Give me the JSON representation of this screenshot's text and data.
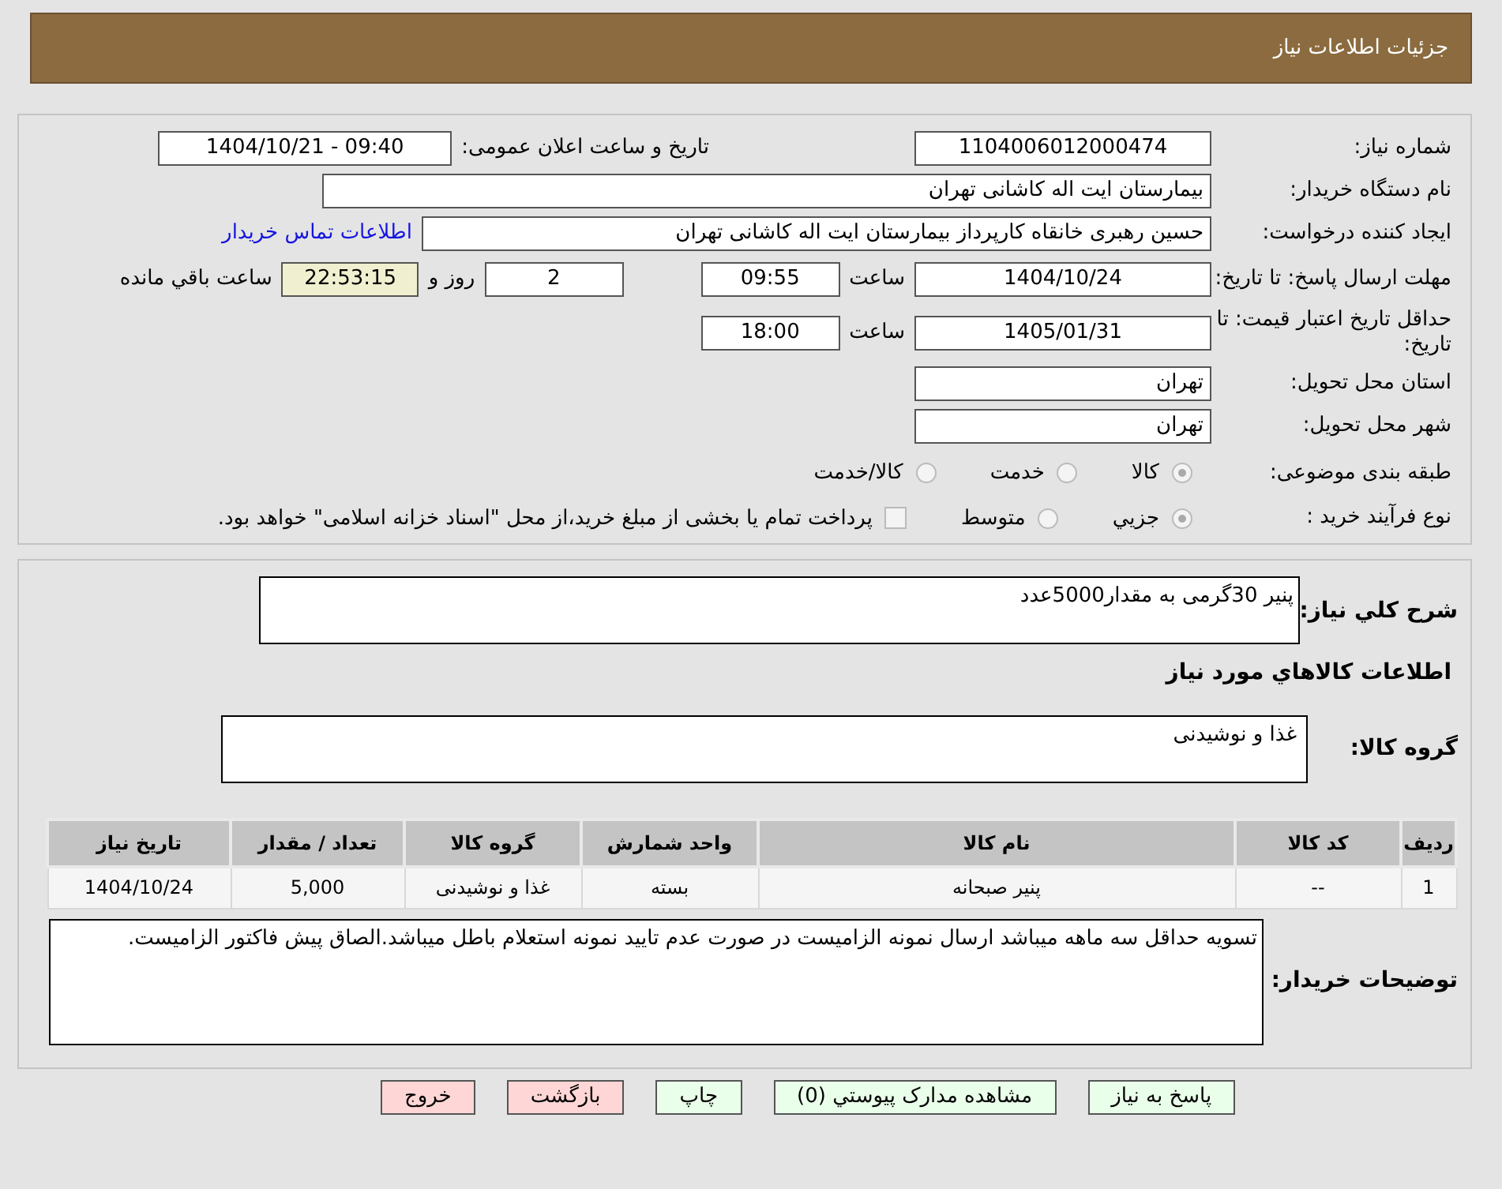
{
  "header": {
    "title": "جزئیات اطلاعات نیاز"
  },
  "fields": {
    "need_number": {
      "label": "شماره نیاز:",
      "value": "1104006012000474"
    },
    "announce": {
      "label": "تاریخ و ساعت اعلان عمومی:",
      "value": "1404/10/21 - 09:40"
    },
    "buyer": {
      "label": "نام دستگاه خریدار:",
      "value": "بیمارستان ایت اله کاشانی تهران"
    },
    "requester": {
      "label": "ایجاد کننده درخواست:",
      "value": "حسین رهبری خانقاه کارپرداز بیمارستان ایت اله کاشانی تهران",
      "link": "اطلاعات تماس خریدار"
    },
    "deadline": {
      "label": "مهلت ارسال پاسخ: تا تاریخ:",
      "date": "1404/10/24",
      "time_label": "ساعت",
      "time": "09:55",
      "days": "2",
      "days_label": "روز و",
      "remaining": "22:53:15",
      "remaining_label": "ساعت باقي مانده"
    },
    "validity": {
      "label": "حداقل تاریخ اعتبار قیمت: تا تاریخ:",
      "date": "1405/01/31",
      "time_label": "ساعت",
      "time": "18:00"
    },
    "province": {
      "label": "استان محل تحویل:",
      "value": "تهران"
    },
    "city": {
      "label": "شهر محل تحویل:",
      "value": "تهران"
    },
    "category": {
      "label": "طبقه بندی موضوعی:",
      "options": [
        {
          "label": "کالا",
          "selected": true
        },
        {
          "label": "خدمت",
          "selected": false
        },
        {
          "label": "کالا/خدمت",
          "selected": false
        }
      ]
    },
    "process": {
      "label": "نوع فرآیند خرید :",
      "options": [
        {
          "label": "جزیي",
          "selected": true
        },
        {
          "label": "متوسط",
          "selected": false
        }
      ],
      "payment": {
        "checked": false,
        "label": "پرداخت تمام یا بخشی از مبلغ خرید،از محل \"اسناد خزانه اسلامی\" خواهد بود."
      }
    }
  },
  "summary": {
    "label": "شرح کلي نیاز:",
    "value": "پنیر 30گرمی به مقدار5000عدد"
  },
  "goods_heading": "اطلاعات کالاهاي مورد نیاز",
  "goods_group": {
    "label": "گروه کالا:",
    "value": "غذا و نوشیدنی"
  },
  "table": {
    "columns": [
      "ردیف",
      "کد کالا",
      "نام کالا",
      "واحد شمارش",
      "گروه کالا",
      "تعداد / مقدار",
      "تاریخ نیاز"
    ],
    "rows": [
      [
        "1",
        "--",
        "پنیر صبحانه",
        "بسته",
        "غذا و نوشیدنی",
        "5,000",
        "1404/10/24"
      ]
    ]
  },
  "notes": {
    "label": "توضیحات خریدار:",
    "value": "تسویه حداقل سه ماهه میباشد ارسال نمونه الزامیست در صورت عدم تایید نمونه استعلام باطل میباشد.الصاق پیش فاکتور الزامیست."
  },
  "buttons": [
    {
      "label": "پاسخ به نیاز",
      "kind": "green"
    },
    {
      "label": "مشاهده مدارک پیوستي (0)",
      "kind": "green"
    },
    {
      "label": "چاپ",
      "kind": "green"
    },
    {
      "label": "بازگشت",
      "kind": "red"
    },
    {
      "label": "خروج",
      "kind": "red"
    }
  ]
}
